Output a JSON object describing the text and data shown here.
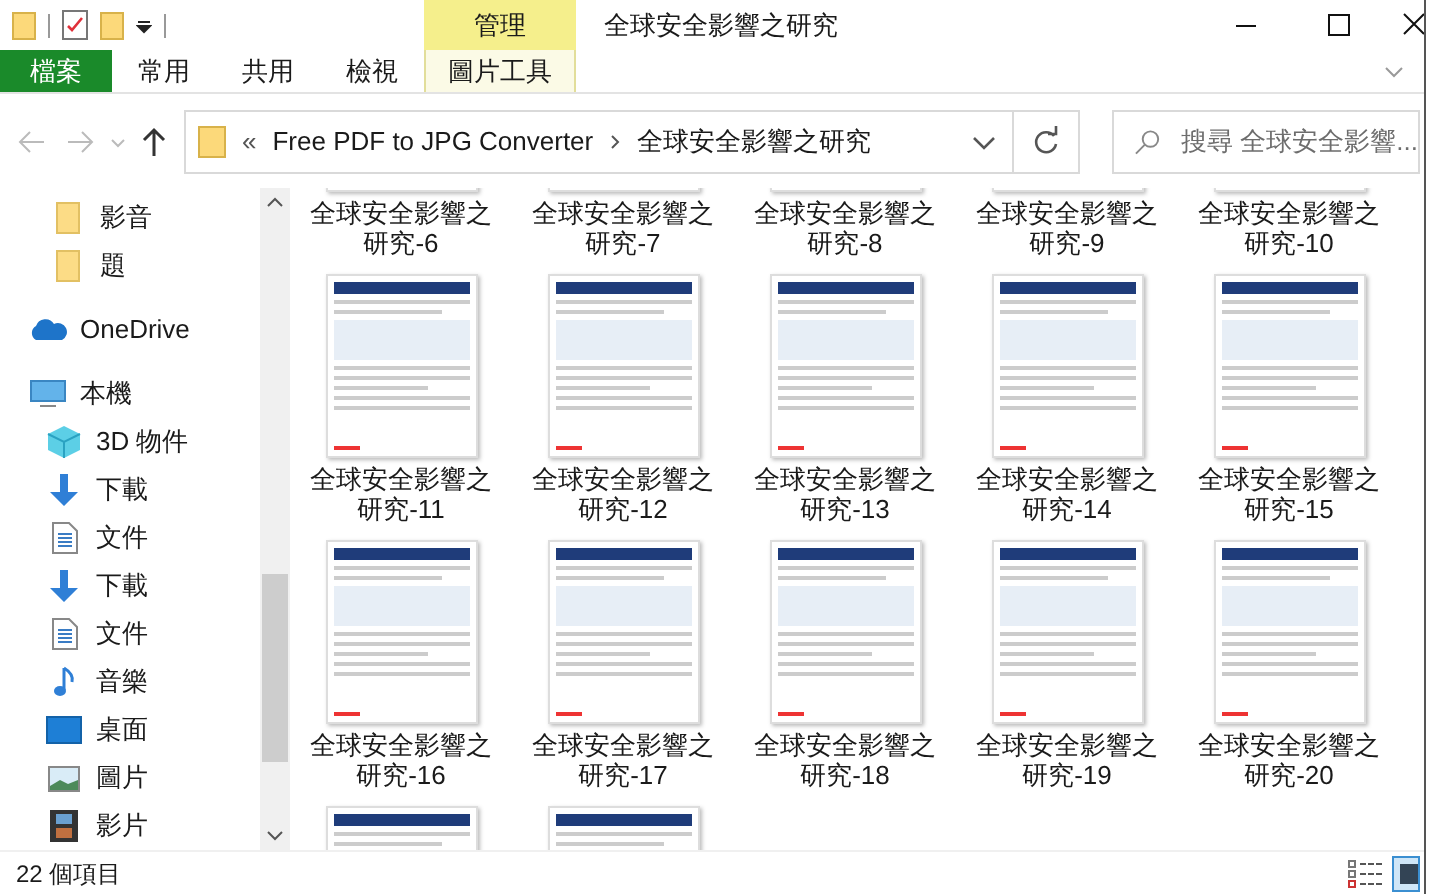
{
  "window": {
    "title": "全球安全影響之研究"
  },
  "ribbon": {
    "context_header": "管理",
    "tabs": [
      {
        "label": "檔案",
        "kind": "file"
      },
      {
        "label": "常用",
        "kind": "tab"
      },
      {
        "label": "共用",
        "kind": "tab"
      },
      {
        "label": "檢視",
        "kind": "tab"
      },
      {
        "label": "圖片工具",
        "kind": "context"
      }
    ]
  },
  "address_bar": {
    "overflow": "«",
    "path": [
      {
        "label": "Free PDF to JPG Converter"
      },
      {
        "label": "全球安全影響之研究"
      }
    ]
  },
  "search": {
    "placeholder": "搜尋 全球安全影響..."
  },
  "sidebar": {
    "items": [
      {
        "label": "影音",
        "kind": "folder"
      },
      {
        "label": "題",
        "kind": "folder"
      },
      {
        "label": "OneDrive",
        "kind": "cloud"
      },
      {
        "label": "本機",
        "kind": "pc",
        "children": [
          {
            "label": "3D 物件",
            "kind": "cube"
          },
          {
            "label": "下載",
            "kind": "download"
          },
          {
            "label": "文件",
            "kind": "document"
          },
          {
            "label": "下載",
            "kind": "download"
          },
          {
            "label": "文件",
            "kind": "document"
          },
          {
            "label": "音樂",
            "kind": "music"
          },
          {
            "label": "桌面",
            "kind": "desktop"
          },
          {
            "label": "圖片",
            "kind": "pictures"
          },
          {
            "label": "影片",
            "kind": "video"
          }
        ]
      }
    ]
  },
  "files": [
    {
      "kind": "labeled",
      "label": "全球安全影響之研究-6"
    },
    {
      "kind": "labeled",
      "label": "全球安全影響之研究-7"
    },
    {
      "kind": "labeled",
      "label": "全球安全影響之研究-8"
    },
    {
      "kind": "labeled",
      "label": "全球安全影響之研究-9"
    },
    {
      "kind": "labeled",
      "label": "全球安全影響之研究-10"
    },
    {
      "kind": "labeled",
      "label": "全球安全影響之研究-11"
    },
    {
      "kind": "labeled",
      "label": "全球安全影響之研究-12"
    },
    {
      "kind": "labeled",
      "label": "全球安全影響之研究-13"
    },
    {
      "kind": "labeled",
      "label": "全球安全影響之研究-14"
    },
    {
      "kind": "labeled",
      "label": "全球安全影響之研究-15"
    },
    {
      "kind": "labeled",
      "label": "全球安全影響之研究-16"
    },
    {
      "kind": "labeled",
      "label": "全球安全影響之研究-17"
    },
    {
      "kind": "labeled",
      "label": "全球安全影響之研究-18"
    },
    {
      "kind": "labeled",
      "label": "全球安全影響之研究-19"
    },
    {
      "kind": "labeled",
      "label": "全球安全影響之研究-20"
    },
    {
      "kind": "thumb-only"
    },
    {
      "kind": "thumb-only"
    }
  ],
  "status_bar": {
    "item_count": "22 個項目"
  }
}
